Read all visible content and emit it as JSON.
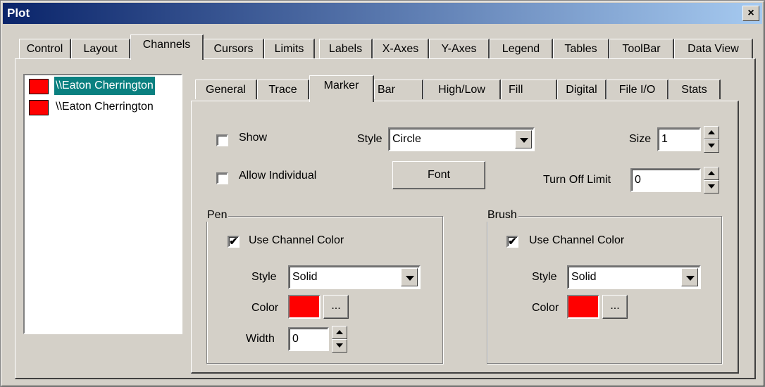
{
  "window": {
    "title": "Plot",
    "close_glyph": "×"
  },
  "main_tabs": [
    "Control",
    "Layout",
    "Channels",
    "Cursors",
    "Limits",
    "Labels",
    "X-Axes",
    "Y-Axes",
    "Legend",
    "Tables",
    "ToolBar",
    "Data View"
  ],
  "selected_main_tab": "Channels",
  "channels": [
    {
      "label": "\\\\Eaton Cherrington",
      "color": "#ff0000",
      "selected": true
    },
    {
      "label": "\\\\Eaton Cherrington",
      "color": "#ff0000",
      "selected": false
    }
  ],
  "sub_tabs": [
    "General",
    "Trace",
    "Marker",
    "Bar",
    "High/Low",
    "Fill",
    "Digital",
    "File I/O",
    "Stats"
  ],
  "selected_sub_tab": "Marker",
  "marker": {
    "show_label": "Show",
    "show_checked": false,
    "allow_individual_label": "Allow Individual",
    "allow_individual_checked": false,
    "style_label": "Style",
    "style_value": "Circle",
    "font_button": "Font",
    "size_label": "Size",
    "size_value": "1",
    "turn_off_limit_label": "Turn Off Limit",
    "turn_off_limit_value": "0"
  },
  "pen": {
    "title": "Pen",
    "use_channel_color_label": "Use Channel Color",
    "use_channel_color_checked": true,
    "style_label": "Style",
    "style_value": "Solid",
    "color_label": "Color",
    "color_value": "#ff0000",
    "browse_button": "...",
    "width_label": "Width",
    "width_value": "0"
  },
  "brush": {
    "title": "Brush",
    "use_channel_color_label": "Use Channel Color",
    "use_channel_color_checked": true,
    "style_label": "Style",
    "style_value": "Solid",
    "color_label": "Color",
    "color_value": "#ff0000",
    "browse_button": "..."
  },
  "check_glyph": "✔"
}
